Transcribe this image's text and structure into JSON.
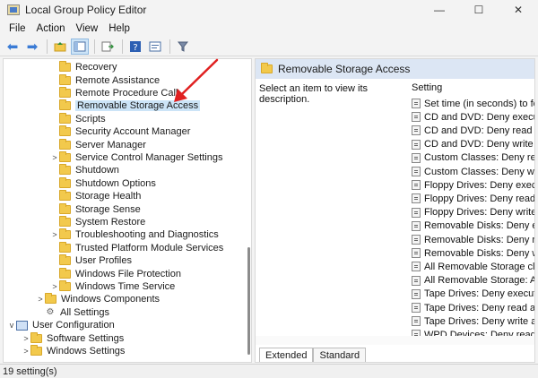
{
  "window": {
    "title": "Local Group Policy Editor"
  },
  "window_controls": {
    "minimize": "—",
    "maximize": "☐",
    "close": "✕"
  },
  "menu": [
    "File",
    "Action",
    "View",
    "Help"
  ],
  "tree": {
    "items": [
      {
        "label": "Recovery",
        "expander": "",
        "icon": "folder-icon"
      },
      {
        "label": "Remote Assistance",
        "expander": "",
        "icon": "folder-icon"
      },
      {
        "label": "Remote Procedure Call",
        "expander": "",
        "icon": "folder-icon"
      },
      {
        "label": "Removable Storage Access",
        "expander": "",
        "icon": "folder-icon",
        "selected": true
      },
      {
        "label": "Scripts",
        "expander": "",
        "icon": "folder-icon"
      },
      {
        "label": "Security Account Manager",
        "expander": "",
        "icon": "folder-icon"
      },
      {
        "label": "Server Manager",
        "expander": "",
        "icon": "folder-icon"
      },
      {
        "label": "Service Control Manager Settings",
        "expander": ">",
        "icon": "folder-icon"
      },
      {
        "label": "Shutdown",
        "expander": "",
        "icon": "folder-icon"
      },
      {
        "label": "Shutdown Options",
        "expander": "",
        "icon": "folder-icon"
      },
      {
        "label": "Storage Health",
        "expander": "",
        "icon": "folder-icon"
      },
      {
        "label": "Storage Sense",
        "expander": "",
        "icon": "folder-icon"
      },
      {
        "label": "System Restore",
        "expander": "",
        "icon": "folder-icon"
      },
      {
        "label": "Troubleshooting and Diagnostics",
        "expander": ">",
        "icon": "folder-icon"
      },
      {
        "label": "Trusted Platform Module Services",
        "expander": "",
        "icon": "folder-icon"
      },
      {
        "label": "User Profiles",
        "expander": "",
        "icon": "folder-icon"
      },
      {
        "label": "Windows File Protection",
        "expander": "",
        "icon": "folder-icon"
      },
      {
        "label": "Windows Time Service",
        "expander": ">",
        "icon": "folder-icon"
      },
      {
        "label": "Windows Components",
        "expander": ">",
        "icon": "folder-icon"
      },
      {
        "label": "All Settings",
        "expander": "",
        "icon": "settings-icon"
      },
      {
        "label": "User Configuration",
        "expander": "v",
        "icon": "computer-icon"
      },
      {
        "label": "Software Settings",
        "expander": ">",
        "icon": "folder-icon"
      },
      {
        "label": "Windows Settings",
        "expander": ">",
        "icon": "folder-icon"
      }
    ]
  },
  "right_pane": {
    "header_title": "Removable Storage Access",
    "description": "Select an item to view its description.",
    "setting_header": "Setting",
    "settings": [
      "Set time (in seconds) to for",
      "CD and DVD: Deny execute",
      "CD and DVD: Deny read acc",
      "CD and DVD: Deny write ac",
      "Custom Classes: Deny read",
      "Custom Classes: Deny write",
      "Floppy Drives: Deny execut",
      "Floppy Drives: Deny read ac",
      "Floppy Drives: Deny write a",
      "Removable Disks: Deny exe",
      "Removable Disks: Deny rea",
      "Removable Disks: Deny writ",
      "All Removable Storage clas",
      "All Removable Storage: Allo",
      "Tape Drives: Deny execute a",
      "Tape Drives: Deny read acce",
      "Tape Drives: Deny write acc",
      "WPD Devices: Deny read ac"
    ],
    "tabs": [
      "Extended",
      "Standard"
    ],
    "active_tab": "Extended"
  },
  "status": {
    "text": "19 setting(s)"
  },
  "colors": {
    "accent": "#dce6f4",
    "selection": "#cce4f7",
    "folder": "#f2c94c",
    "annotation": "#e02020"
  }
}
